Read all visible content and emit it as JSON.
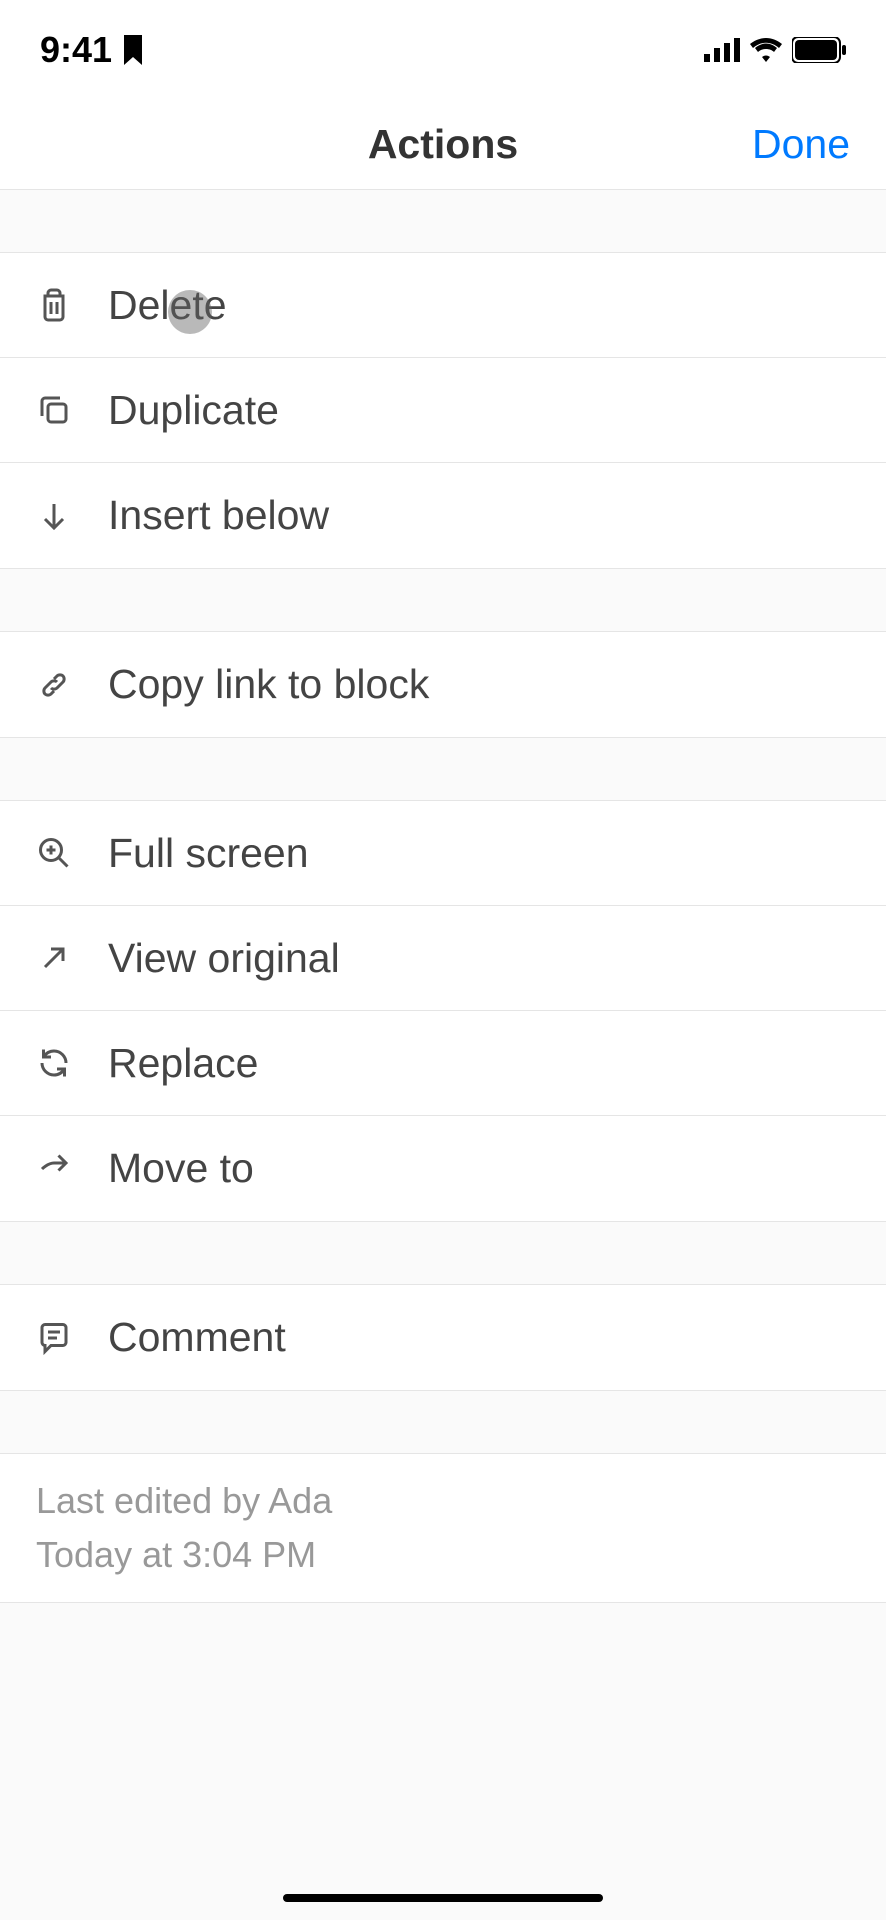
{
  "status": {
    "time": "9:41"
  },
  "header": {
    "title": "Actions",
    "done": "Done"
  },
  "groups": [
    {
      "items": [
        {
          "icon": "trash-icon",
          "label": "Delete"
        },
        {
          "icon": "duplicate-icon",
          "label": "Duplicate"
        },
        {
          "icon": "arrow-down-icon",
          "label": "Insert below"
        }
      ]
    },
    {
      "items": [
        {
          "icon": "link-icon",
          "label": "Copy link to block"
        }
      ]
    },
    {
      "items": [
        {
          "icon": "magnify-plus-icon",
          "label": "Full screen"
        },
        {
          "icon": "arrow-up-right-icon",
          "label": "View original"
        },
        {
          "icon": "refresh-icon",
          "label": "Replace"
        },
        {
          "icon": "arrow-right-icon",
          "label": "Move to"
        }
      ]
    },
    {
      "items": [
        {
          "icon": "comment-icon",
          "label": "Comment"
        }
      ]
    }
  ],
  "footer": {
    "line1": "Last edited by Ada",
    "line2": "Today at 3:04 PM"
  }
}
